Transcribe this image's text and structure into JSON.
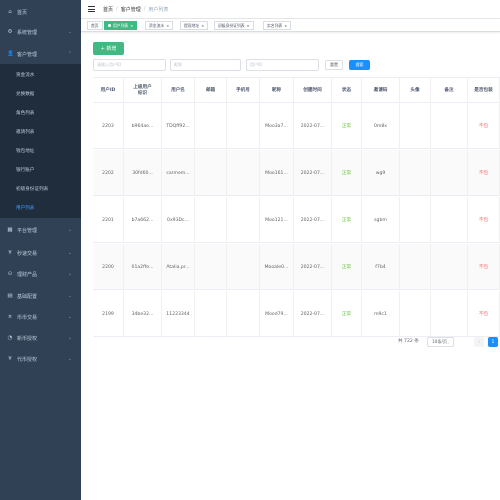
{
  "sidebar": {
    "menu": [
      {
        "icon": "home-icon",
        "glyph": "⌂",
        "label": "首页",
        "arrow": ""
      },
      {
        "icon": "gear-icon",
        "glyph": "⚙",
        "label": "系统管理",
        "arrow": "⌄"
      },
      {
        "icon": "user-icon",
        "glyph": "👤",
        "label": "客户管理",
        "arrow": "⌃"
      }
    ],
    "sub": [
      {
        "label": "资金流水"
      },
      {
        "label": "兑换数据"
      },
      {
        "label": "角色列表"
      },
      {
        "label": "邀请列表"
      },
      {
        "label": "钱包地址"
      },
      {
        "label": "银行账户"
      },
      {
        "label": "初级身份证列表"
      },
      {
        "label": "用户列表"
      }
    ],
    "menu2": [
      {
        "icon": "grid-icon",
        "glyph": "▦",
        "label": "平台管理",
        "arrow": "⌄"
      },
      {
        "icon": "yen-icon",
        "glyph": "¥",
        "label": "秒速交易",
        "arrow": "⌄"
      },
      {
        "icon": "circle-icon",
        "glyph": "⊙",
        "label": "理财产品",
        "arrow": "⌄"
      },
      {
        "icon": "table-icon",
        "glyph": "▤",
        "label": "基础配置",
        "arrow": "⌄"
      },
      {
        "icon": "coin-icon",
        "glyph": "¤",
        "label": "币币交易",
        "arrow": "⌄"
      },
      {
        "icon": "chart-icon",
        "glyph": "◔",
        "label": "新币授权",
        "arrow": "⌄"
      },
      {
        "icon": "money-icon",
        "glyph": "¥",
        "label": "代币授权",
        "arrow": "⌄"
      }
    ]
  },
  "navbar": {
    "crumbs": [
      "首页",
      "客户管理",
      "用户列表"
    ],
    "sep": "/"
  },
  "tags": [
    {
      "label": "首页",
      "close": ""
    },
    {
      "label": "用户列表",
      "close": "×"
    },
    {
      "label": "资金流水",
      "close": "×"
    },
    {
      "label": "提现地址",
      "close": "×"
    },
    {
      "label": "初级身份证列表",
      "close": "×"
    },
    {
      "label": "实名列表",
      "close": "×"
    }
  ],
  "toolbar": {
    "add_label": "+ 新增",
    "search1_placeholder": "请输入用户ID",
    "search2_placeholder": "昵称",
    "search3_placeholder": "用户ID",
    "reset_label": "重置",
    "search_label": "搜索"
  },
  "table": {
    "headers": [
      [
        "用户ID"
      ],
      [
        "上级用户",
        "标识"
      ],
      [
        "用户名"
      ],
      [
        "邮箱"
      ],
      [
        "手机号"
      ],
      [
        "昵称"
      ],
      [
        "创建时间"
      ],
      [
        "状态"
      ],
      [
        "邀请码"
      ],
      [
        "头像"
      ],
      [
        "备注"
      ],
      [
        "是否包装"
      ]
    ],
    "rows": [
      [
        "2203",
        "b964ae...",
        "TDQff92...",
        "",
        "",
        "Moo3a7...",
        "2022-07...",
        "正常",
        "0m8x",
        "",
        "",
        "不包"
      ],
      [
        "2202",
        "30fd60...",
        "carmem...",
        "",
        "",
        "Moo161...",
        "2022-07...",
        "正常",
        "wg9",
        "",
        "",
        "不包"
      ],
      [
        "2201",
        "b7a662...",
        "0x93Dc...",
        "",
        "",
        "Moo121...",
        "2022-07...",
        "正常",
        "sgbm",
        "",
        "",
        "不包"
      ],
      [
        "2200",
        "01a2ffe...",
        "Atalia.pr...",
        "",
        "",
        "Mooale0...",
        "2022-07...",
        "正常",
        "f7b4",
        "",
        "",
        "不包"
      ],
      [
        "2199",
        "34be32...",
        "11223344",
        "",
        "",
        "Mood79...",
        "2022-07...",
        "正常",
        "m9c1",
        "",
        "",
        "不包"
      ]
    ]
  },
  "pager": {
    "total": "共 722 条",
    "size": "10条/页",
    "prev": "‹",
    "page": "1"
  },
  "colors": {
    "sidebar_bg": "#304156",
    "accent": "#42b983",
    "primary": "#1890ff",
    "active_menu": "#409eff"
  }
}
